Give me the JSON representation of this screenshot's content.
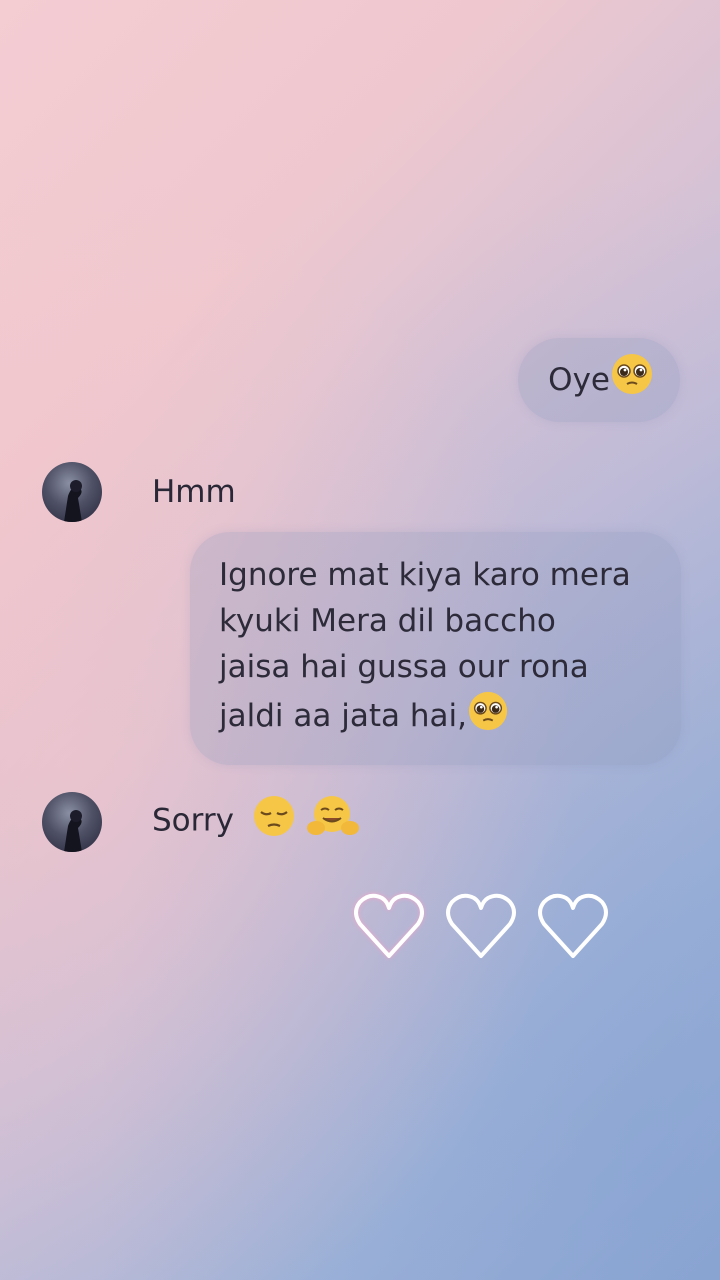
{
  "messages": [
    {
      "direction": "outgoing",
      "text": "Oye",
      "emoji": "pleading-face-emoji"
    },
    {
      "direction": "incoming",
      "text": "Hmm"
    },
    {
      "direction": "outgoing",
      "lines": [
        "Ignore mat kiya karo mera",
        "kyuki Mera dil baccho",
        "jaisa hai gussa our rona",
        "jaldi aa jata hai,"
      ],
      "emoji": "pleading-face-emoji"
    },
    {
      "direction": "incoming",
      "text": "Sorry",
      "emojis": [
        "pensive-face-emoji",
        "hugging-face-emoji"
      ]
    }
  ],
  "reactions": {
    "hearts": [
      "heart-outline-icon",
      "heart-outline-icon",
      "heart-outline-icon"
    ]
  },
  "colors": {
    "bubble": "#8c96b9",
    "text": "#2d2b3a",
    "background_start": "#f3cdd2",
    "background_end": "#8ea6d2",
    "emoji_yellow": "#f6c646"
  }
}
